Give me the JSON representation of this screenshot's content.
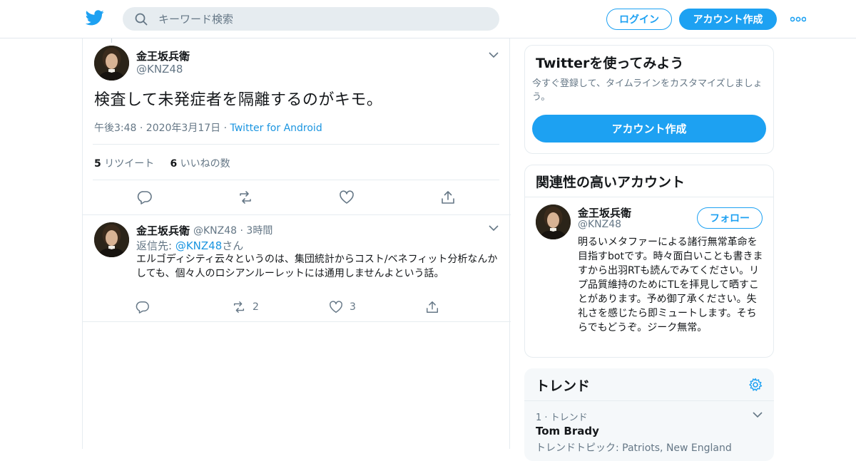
{
  "header": {
    "search_placeholder": "キーワード検索",
    "login_label": "ログイン",
    "signup_label": "アカウント作成"
  },
  "tweet": {
    "author_name": "金王坂兵衛",
    "author_handle": "@KNZ48",
    "text": "検査して未発症者を隔離するのがキモ。",
    "time": "午後3:48 · 2020年3月17日",
    "separator": " · ",
    "source": "Twitter for Android",
    "retweet_count": "5",
    "retweet_label": "リツイート",
    "like_count": "6",
    "like_label": "いいねの数"
  },
  "reply": {
    "author_name": "金王坂兵衛",
    "author_handle": "@KNZ48",
    "age": "· 3時間",
    "reply_prefix": "返信先: ",
    "reply_to": "@KNZ48",
    "reply_suffix": "さん",
    "text": "エルゴディシティ云々というのは、集団統計からコスト/ベネフィット分析なんかしても、個々人のロシアンルーレットには通用しませんよという話。",
    "retweet_count": "2",
    "like_count": "3"
  },
  "signup_card": {
    "title": "Twitterを使ってみよう",
    "subtitle": "今すぐ登録して、タイムラインをカスタマイズしましょう。",
    "button_label": "アカウント作成"
  },
  "related": {
    "title": "関連性の高いアカウント",
    "name": "金王坂兵衛",
    "handle": "@KNZ48",
    "follow_label": "フォロー",
    "bio": "明るいメタファーによる諸行無常革命を目指すbotです。時々面白いことも書きますから出羽RTも読んでみてください。リプ品質維持のためにTLを拝見して晒すことがあります。予め御了承ください。失礼さを感じたら即ミュートします。そちらでもどうぞ。ジーク無常。"
  },
  "trends": {
    "title": "トレンド",
    "item_rank": "1 · トレンド",
    "item_name": "Tom Brady",
    "item_topics": "トレンドトピック: Patriots, New England"
  },
  "colors": {
    "accent": "#1da1f2",
    "link": "#1b95e0",
    "muted": "#657786"
  }
}
